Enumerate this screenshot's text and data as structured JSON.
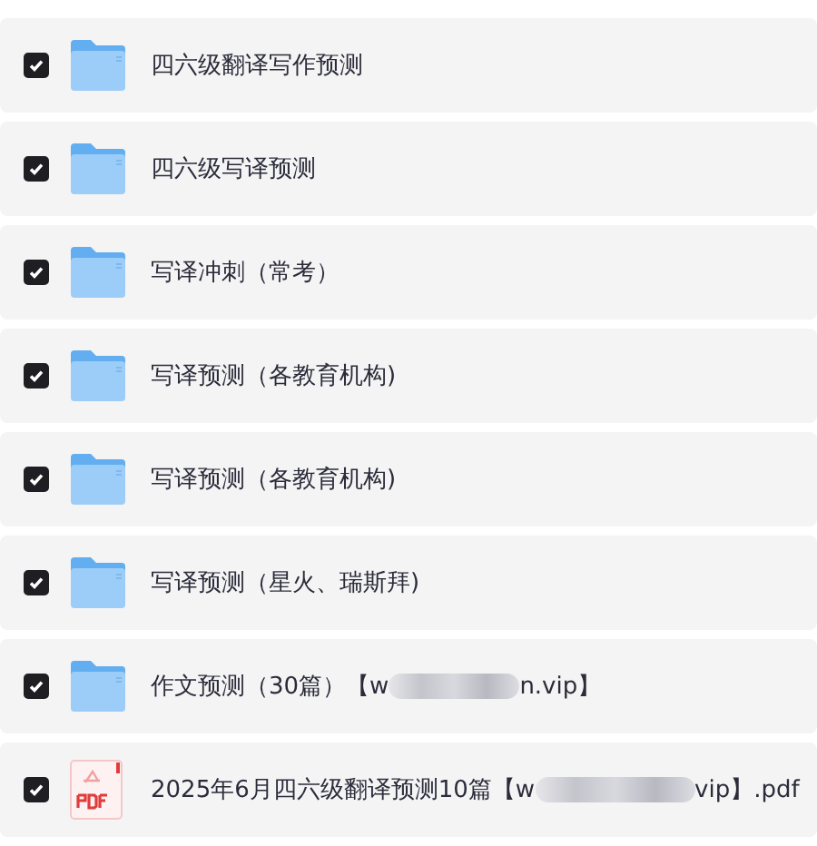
{
  "files": [
    {
      "kind": "folder",
      "checked": true,
      "name": "四六级翻译写作预测"
    },
    {
      "kind": "folder",
      "checked": true,
      "name": "四六级写译预测"
    },
    {
      "kind": "folder",
      "checked": true,
      "name": "写译冲刺（常考）"
    },
    {
      "kind": "folder",
      "checked": true,
      "name": "写译预测（各教育机构)"
    },
    {
      "kind": "folder",
      "checked": true,
      "name": "写译预测（各教育机构)"
    },
    {
      "kind": "folder",
      "checked": true,
      "name": "写译预测（星火、瑞斯拜)"
    },
    {
      "kind": "folder",
      "checked": true,
      "name": "作文预测（30篇）【w",
      "name_after_blur": "n.vip】"
    },
    {
      "kind": "pdf",
      "checked": true,
      "name": "2025年6月四六级翻译预测10篇【w",
      "name_after_blur": "vip】.pdf"
    }
  ]
}
